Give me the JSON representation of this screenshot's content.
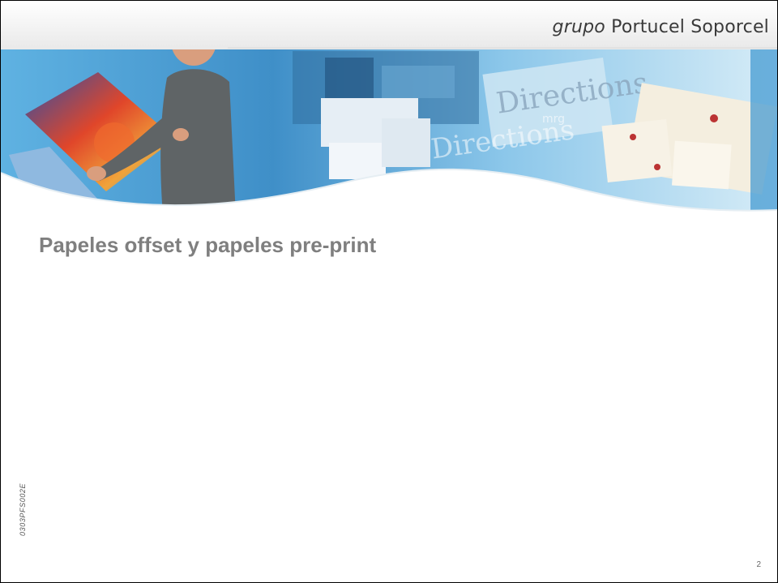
{
  "header": {
    "brand_italic": "grupo",
    "brand_name": "Portucel Soporcel"
  },
  "banner": {
    "sign_text_1": "Directions",
    "sign_text_2": "Directions",
    "sign_text_3": "mrg"
  },
  "slide": {
    "title": "Papeles offset y papeles pre-print",
    "document_code": "0303PFS002E",
    "page_number": "2"
  },
  "colors": {
    "title": "#7f7f7f",
    "banner_blue": "#4a9fd6",
    "banner_light": "#bfe2f4"
  }
}
